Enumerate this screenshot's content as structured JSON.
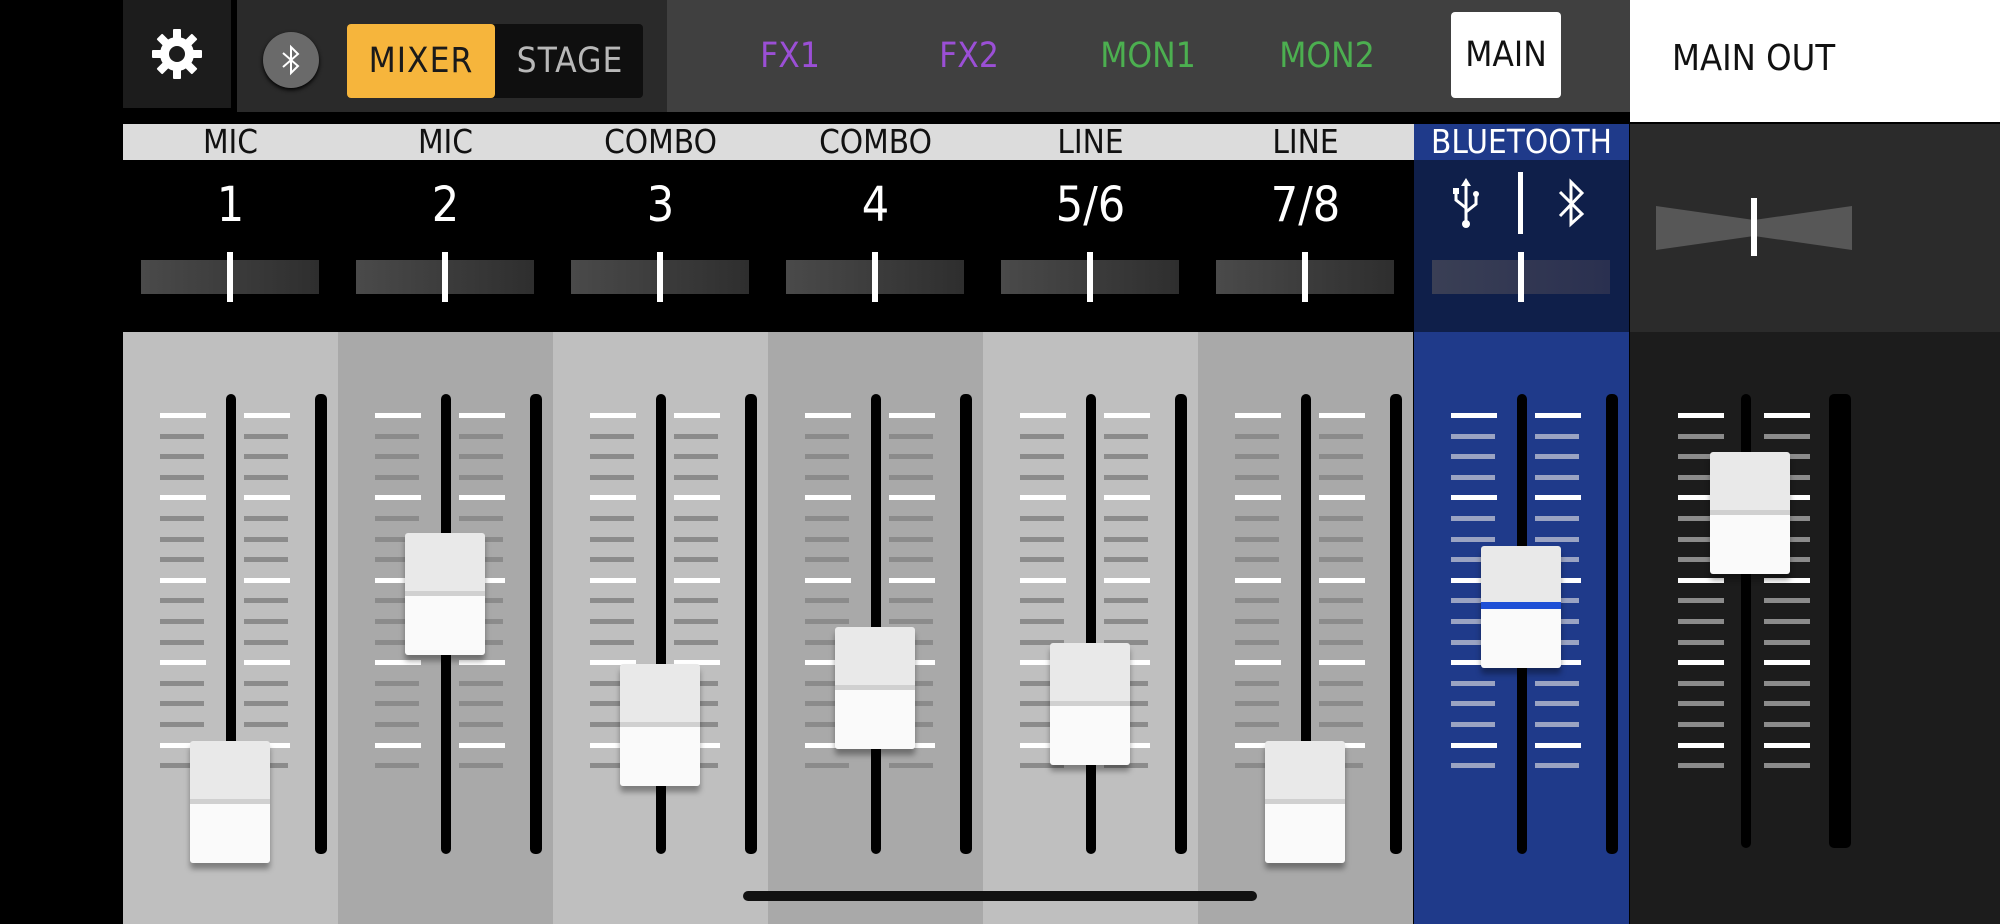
{
  "topbar": {
    "mixer_label": "MIXER",
    "stage_label": "STAGE",
    "active_mode": "MIXER",
    "buses": [
      {
        "label": "FX1",
        "color": "#9b4fd6"
      },
      {
        "label": "FX2",
        "color": "#9b4fd6"
      },
      {
        "label": "MON1",
        "color": "#4caf50"
      },
      {
        "label": "MON2",
        "color": "#4caf50"
      }
    ],
    "main_label": "MAIN",
    "main_out_label": "MAIN OUT",
    "icons": [
      "gear-icon",
      "bluetooth-icon"
    ]
  },
  "channels": [
    {
      "type": "MIC",
      "number": "1",
      "fader_level": 0.08,
      "pan": 0.5
    },
    {
      "type": "MIC",
      "number": "2",
      "fader_level": 0.59,
      "pan": 0.5
    },
    {
      "type": "COMBO",
      "number": "3",
      "fader_level": 0.27,
      "pan": 0.5
    },
    {
      "type": "COMBO",
      "number": "4",
      "fader_level": 0.36,
      "pan": 0.5
    },
    {
      "type": "LINE",
      "number": "5/6",
      "fader_level": 0.32,
      "pan": 0.5
    },
    {
      "type": "LINE",
      "number": "7/8",
      "fader_level": 0.08,
      "pan": 0.5
    }
  ],
  "bluetooth_channel": {
    "type": "BLUETOOTH",
    "icons": [
      "usb-icon",
      "bluetooth-icon"
    ],
    "fader_level": 0.56,
    "pan": 0.5
  },
  "main_out": {
    "fader_level": 0.79,
    "pan": 0.5
  },
  "colors": {
    "accent": "#f6b53c",
    "bluetooth_blue": "#1f3a8a",
    "fx": "#9b4fd6",
    "mon": "#4caf50"
  }
}
